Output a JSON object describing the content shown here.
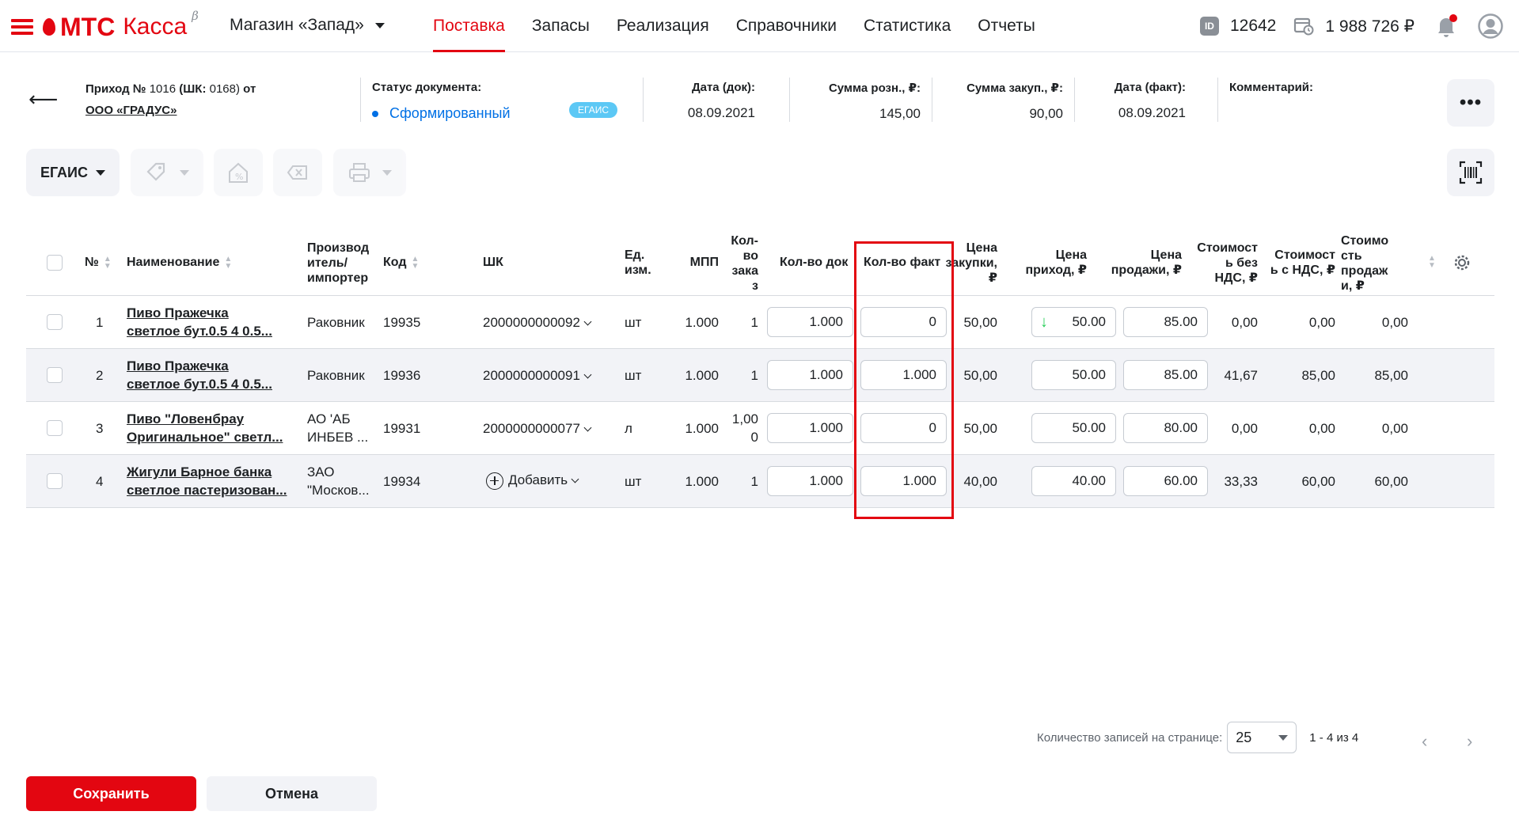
{
  "header": {
    "brand_mts": "МТС",
    "brand_kassa": "Касса",
    "brand_beta": "β",
    "store": "Магазин «Запад»",
    "nav": [
      "Поставка",
      "Запасы",
      "Реализация",
      "Справочники",
      "Статистика",
      "Отчеты"
    ],
    "active_nav": "Поставка",
    "id_badge": "ID",
    "id_number": "12642",
    "balance": "1 988 726 ₽"
  },
  "document": {
    "title_prefix": "Приход №",
    "number": "1016",
    "shk_label": "(ШК:",
    "shk_value": "0168)",
    "title_suffix": "от",
    "supplier": "ООО «ГРАДУС»",
    "status_label": "Статус документа:",
    "status_value": "Сформированный",
    "egais_badge": "ЕГАИС",
    "date_doc_label": "Дата (док):",
    "date_doc": "08.09.2021",
    "sum_retail_label": "Сумма розн., ₽:",
    "sum_retail": "145,00",
    "sum_purchase_label": "Сумма закуп., ₽:",
    "sum_purchase": "90,00",
    "date_fact_label": "Дата (факт):",
    "date_fact": "08.09.2021",
    "comment_label": "Комментарий:"
  },
  "toolbar": {
    "egais_label": "ЕГАИС"
  },
  "columns": {
    "num": "№",
    "name": "Наименование",
    "producer_1": "Производ",
    "producer_2": "итель/",
    "producer_3": "импортер",
    "code": "Код",
    "shk": "ШК",
    "unit_1": "Ед.",
    "unit_2": "изм.",
    "mpp": "МПП",
    "qty_order_1": "Кол-",
    "qty_order_2": "во",
    "qty_order_3": "зака",
    "qty_order_4": "з",
    "qty_doc": "Кол-во док",
    "qty_fact": "Кол-во факт",
    "price_purchase_1": "Цена",
    "price_purchase_2": "закупки,",
    "price_purchase_3": "₽",
    "price_in_1": "Цена",
    "price_in_2": "приход, ₽",
    "price_sale_1": "Цена",
    "price_sale_2": "продажи, ₽",
    "cost_novat_1": "Стоимост",
    "cost_novat_2": "ь без",
    "cost_novat_3": "НДС, ₽",
    "cost_vat_1": "Стоимост",
    "cost_vat_2": "ь с НДС, ₽",
    "cost_sale_1": "Стоимо",
    "cost_sale_2": "сть",
    "cost_sale_3": "продаж",
    "cost_sale_4": "и, ₽"
  },
  "rows": [
    {
      "num": "1",
      "name_1": "Пиво Пражечка",
      "name_2": "светлое бут.0.5 4 0.5...",
      "producer_1": "Раковник",
      "producer_2": "",
      "code": "19935",
      "shk": "2000000000092",
      "unit": "шт",
      "mpp": "1.000",
      "qty_order_1": "1",
      "qty_order_2": "",
      "qty_doc": "1.000",
      "qty_fact": "0",
      "price_purchase": "50,00",
      "price_in": "50.00",
      "price_sale": "85.00",
      "cost_novat": "0,00",
      "cost_vat": "0,00",
      "cost_sale": "0,00"
    },
    {
      "num": "2",
      "name_1": "Пиво Пражечка",
      "name_2": "светлое бут.0.5 4 0.5...",
      "producer_1": "Раковник",
      "producer_2": "",
      "code": "19936",
      "shk": "2000000000091",
      "unit": "шт",
      "mpp": "1.000",
      "qty_order_1": "1",
      "qty_order_2": "",
      "qty_doc": "1.000",
      "qty_fact": "1.000",
      "price_purchase": "50,00",
      "price_in": "50.00",
      "price_sale": "85.00",
      "cost_novat": "41,67",
      "cost_vat": "85,00",
      "cost_sale": "85,00"
    },
    {
      "num": "3",
      "name_1": "Пиво \"Ловенбрау",
      "name_2": "Оригинальное\" светл...",
      "producer_1": "АО 'АБ",
      "producer_2": "ИНБЕВ ...",
      "code": "19931",
      "shk": "2000000000077",
      "unit": "л",
      "mpp": "1.000",
      "qty_order_1": "1,00",
      "qty_order_2": "0",
      "qty_doc": "1.000",
      "qty_fact": "0",
      "price_purchase": "50,00",
      "price_in": "50.00",
      "price_sale": "80.00",
      "cost_novat": "0,00",
      "cost_vat": "0,00",
      "cost_sale": "0,00"
    },
    {
      "num": "4",
      "name_1": "Жигули Барное банка",
      "name_2": "светлое пастеризован...",
      "producer_1": "ЗАО",
      "producer_2": "\"Москов...",
      "code": "19934",
      "shk": "Добавить",
      "unit": "шт",
      "mpp": "1.000",
      "qty_order_1": "1",
      "qty_order_2": "",
      "qty_doc": "1.000",
      "qty_fact": "1.000",
      "price_purchase": "40,00",
      "price_in": "40.00",
      "price_sale": "60.00",
      "cost_novat": "33,33",
      "cost_vat": "60,00",
      "cost_sale": "60,00"
    }
  ],
  "pagination": {
    "per_page_label": "Количество записей на странице:",
    "per_page": "25",
    "range": "1 - 4 из 4"
  },
  "actions": {
    "save": "Сохранить",
    "cancel": "Отмена"
  },
  "colors": {
    "brand_red": "#e30611",
    "status_blue": "#0070e5",
    "price_arrow_green": "#26cd58",
    "egais_badge": "#5cc8f5"
  }
}
